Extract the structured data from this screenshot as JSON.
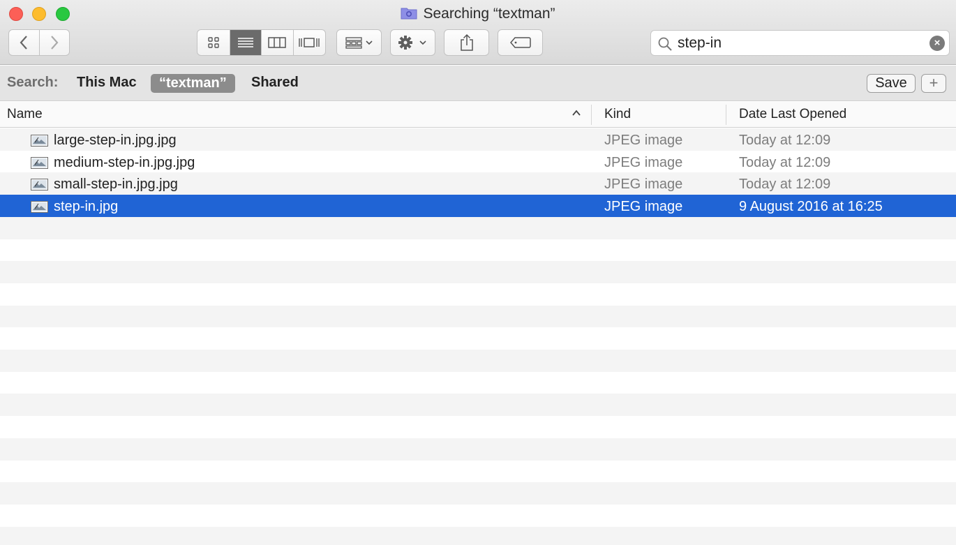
{
  "window": {
    "title": "Searching “textman”",
    "title_icon": "smart-folder-icon"
  },
  "toolbar": {
    "back_icon": "chevron-left-icon",
    "forward_icon": "chevron-right-icon",
    "view_modes": [
      "icon-view",
      "list-view",
      "column-view",
      "cover-flow-view"
    ],
    "active_view": "list-view",
    "arrange_icon": "arrange-icon",
    "action_icon": "gear-icon",
    "share_icon": "share-icon",
    "tag_icon": "tag-icon"
  },
  "search": {
    "value": "step-in",
    "icon": "magnifier-icon",
    "clear_icon": "clear-icon"
  },
  "scope": {
    "label": "Search:",
    "options": [
      "This Mac",
      "“textman”",
      "Shared"
    ],
    "selected": "“textman”",
    "save_label": "Save",
    "add_label": "+"
  },
  "columns": {
    "name": "Name",
    "kind": "Kind",
    "date": "Date Last Opened",
    "sort_icon": "chevron-up-icon"
  },
  "files": [
    {
      "name": "large-step-in.jpg.jpg",
      "kind": "JPEG image",
      "date": "Today at 12:09",
      "selected": false
    },
    {
      "name": "medium-step-in.jpg.jpg",
      "kind": "JPEG image",
      "date": "Today at 12:09",
      "selected": false
    },
    {
      "name": "small-step-in.jpg.jpg",
      "kind": "JPEG image",
      "date": "Today at 12:09",
      "selected": false
    },
    {
      "name": "step-in.jpg",
      "kind": "JPEG image",
      "date": "9 August 2016 at 16:25",
      "selected": true
    }
  ],
  "colors": {
    "selection": "#2064d5",
    "stripe": "#f4f4f4"
  }
}
